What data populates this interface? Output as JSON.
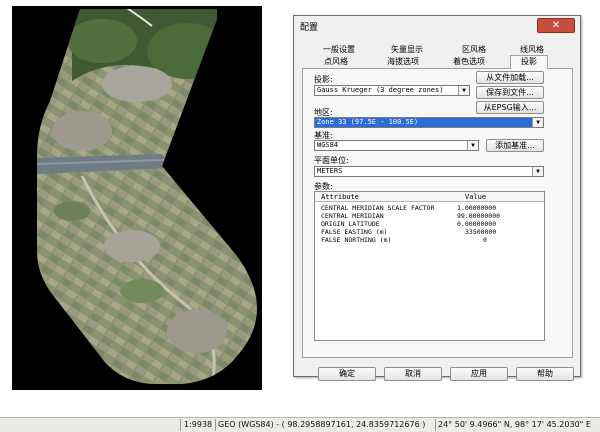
{
  "dialog": {
    "title": "配置",
    "close_glyph": "✕",
    "tabs_row1": [
      "一般设置",
      "矢量显示",
      "区风格",
      "线风格"
    ],
    "tabs_row2": [
      "点风格",
      "海拔选项",
      "着色选项",
      "投影"
    ],
    "active_tab": "投影",
    "projection": {
      "label": "投影:",
      "value": "Gauss Krueger (3 degree zones)",
      "btn_load": "从文件加载...",
      "btn_save": "保存到文件...",
      "btn_epsg": "从EPSG输入..."
    },
    "zone": {
      "label": "地区:",
      "value": "Zone 33 (97.5E - 100.5E)"
    },
    "datum": {
      "label": "基准:",
      "value": "WGS84",
      "btn_add": "添加基准..."
    },
    "units": {
      "label": "平面单位:",
      "value": "METERS"
    },
    "params": {
      "label": "参数:",
      "header_attr": "Attribute",
      "header_value": "Value",
      "rows": [
        {
          "attr": "CENTRAL MERIDIAN SCALE FACTOR",
          "value": "1.00000000"
        },
        {
          "attr": "CENTRAL MERIDIAN",
          "value": "99.00000000"
        },
        {
          "attr": "ORIGIN LATITUDE",
          "value": "0.00000000"
        },
        {
          "attr": "FALSE EASTING (m)",
          "value": "33500000"
        },
        {
          "attr": "FALSE NORTHING (m)",
          "value": "0"
        }
      ]
    },
    "buttons": {
      "ok": "确定",
      "cancel": "取消",
      "apply": "应用",
      "help": "帮助"
    }
  },
  "statusbar": {
    "scale": "1:9938",
    "coords": "GEO (WGS84) - ( 98.2958897161, 24.8359712676 )",
    "dms": "24° 50' 9.4966\" N, 98° 17' 45.2030\" E"
  },
  "colors": {
    "selection": "#2d6cd8",
    "close": "#c74e3c",
    "viewer_bg": "#000000"
  },
  "icons": [
    "close-icon",
    "dropdown-arrow-icon"
  ]
}
